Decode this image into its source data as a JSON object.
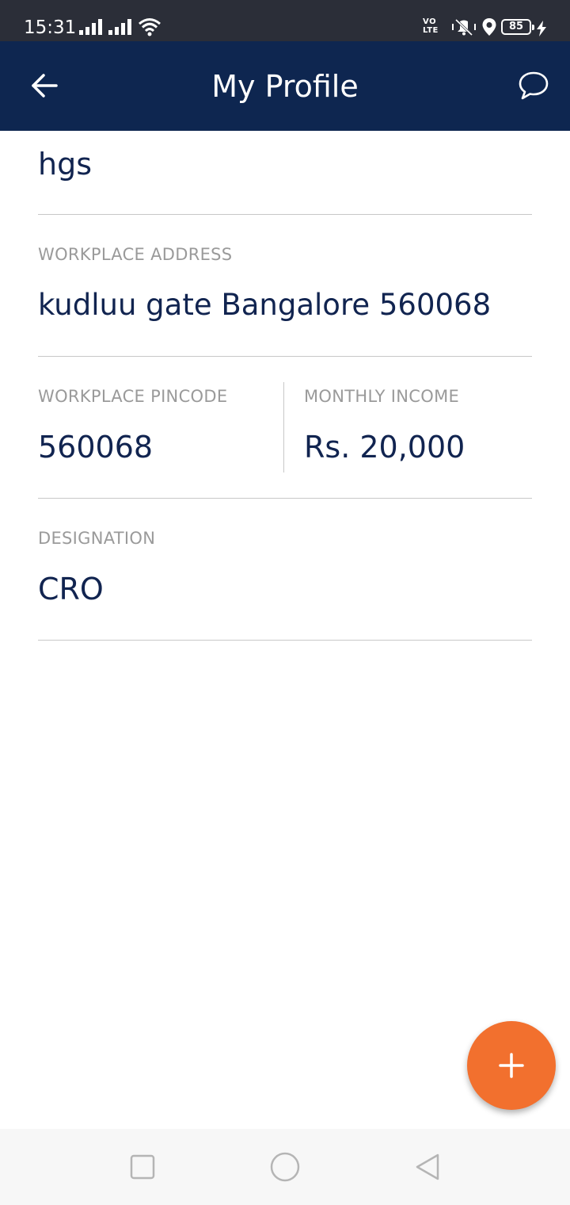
{
  "status_bar": {
    "time": "15:31",
    "volte_line1": "VO",
    "volte_line2": "LTE",
    "battery": "85",
    "icons": [
      "signal-icon",
      "signal-icon",
      "wifi-icon",
      "volte-icon",
      "mute-vibrate-icon",
      "location-icon",
      "battery-icon",
      "charging-icon"
    ]
  },
  "app_bar": {
    "title": "My Profile",
    "back_icon": "arrow-left-icon",
    "chat_icon": "chat-bubble-icon",
    "background": "#0e2650"
  },
  "profile": {
    "name_value": "hgs",
    "workplace_address_label": "WORKPLACE ADDRESS",
    "workplace_address_value": "kudluu gate Bangalore 560068",
    "workplace_pincode_label": "WORKPLACE PINCODE",
    "workplace_pincode_value": "560068",
    "monthly_income_label": "MONTHLY INCOME",
    "monthly_income_value": "Rs. 20,000",
    "designation_label": "DESIGNATION",
    "designation_value": "CRO"
  },
  "fab": {
    "icon": "plus-icon",
    "color": "#f2702e"
  },
  "nav_bar": {
    "icons": [
      "recents-square-icon",
      "home-circle-icon",
      "back-triangle-icon"
    ]
  },
  "colors": {
    "value_text": "#112450",
    "label_text": "#9a9a9a",
    "divider": "#c8c8c8"
  }
}
